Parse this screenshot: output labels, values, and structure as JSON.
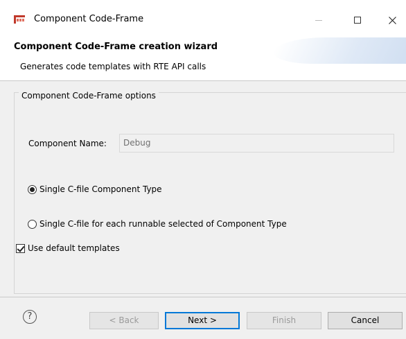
{
  "window": {
    "title": "Component Code-Frame",
    "controls": {
      "minimize": "—",
      "maximize": "□",
      "close": "✕"
    }
  },
  "wizard": {
    "title": "Component Code-Frame creation wizard",
    "description": "Generates code templates with RTE API calls"
  },
  "options": {
    "group_label": "Component Code-Frame options",
    "component_name_label": "Component Name:",
    "component_name_value": "Debug",
    "radio_single": {
      "label": "Single C-file Component Type",
      "selected": true
    },
    "radio_each": {
      "label": "Single C-file for each runnable selected of Component Type",
      "selected": false
    },
    "use_default_templates": {
      "label": "Use default templates",
      "checked": true
    }
  },
  "footer": {
    "help": "?",
    "back_label": "< Back",
    "next_label": "Next >",
    "finish_label": "Finish",
    "cancel_label": "Cancel"
  },
  "colors": {
    "accent": "#0078d7",
    "content_bg": "#f0f0f0",
    "banner": "#c7d8ee",
    "app_icon": "#c0392b"
  }
}
